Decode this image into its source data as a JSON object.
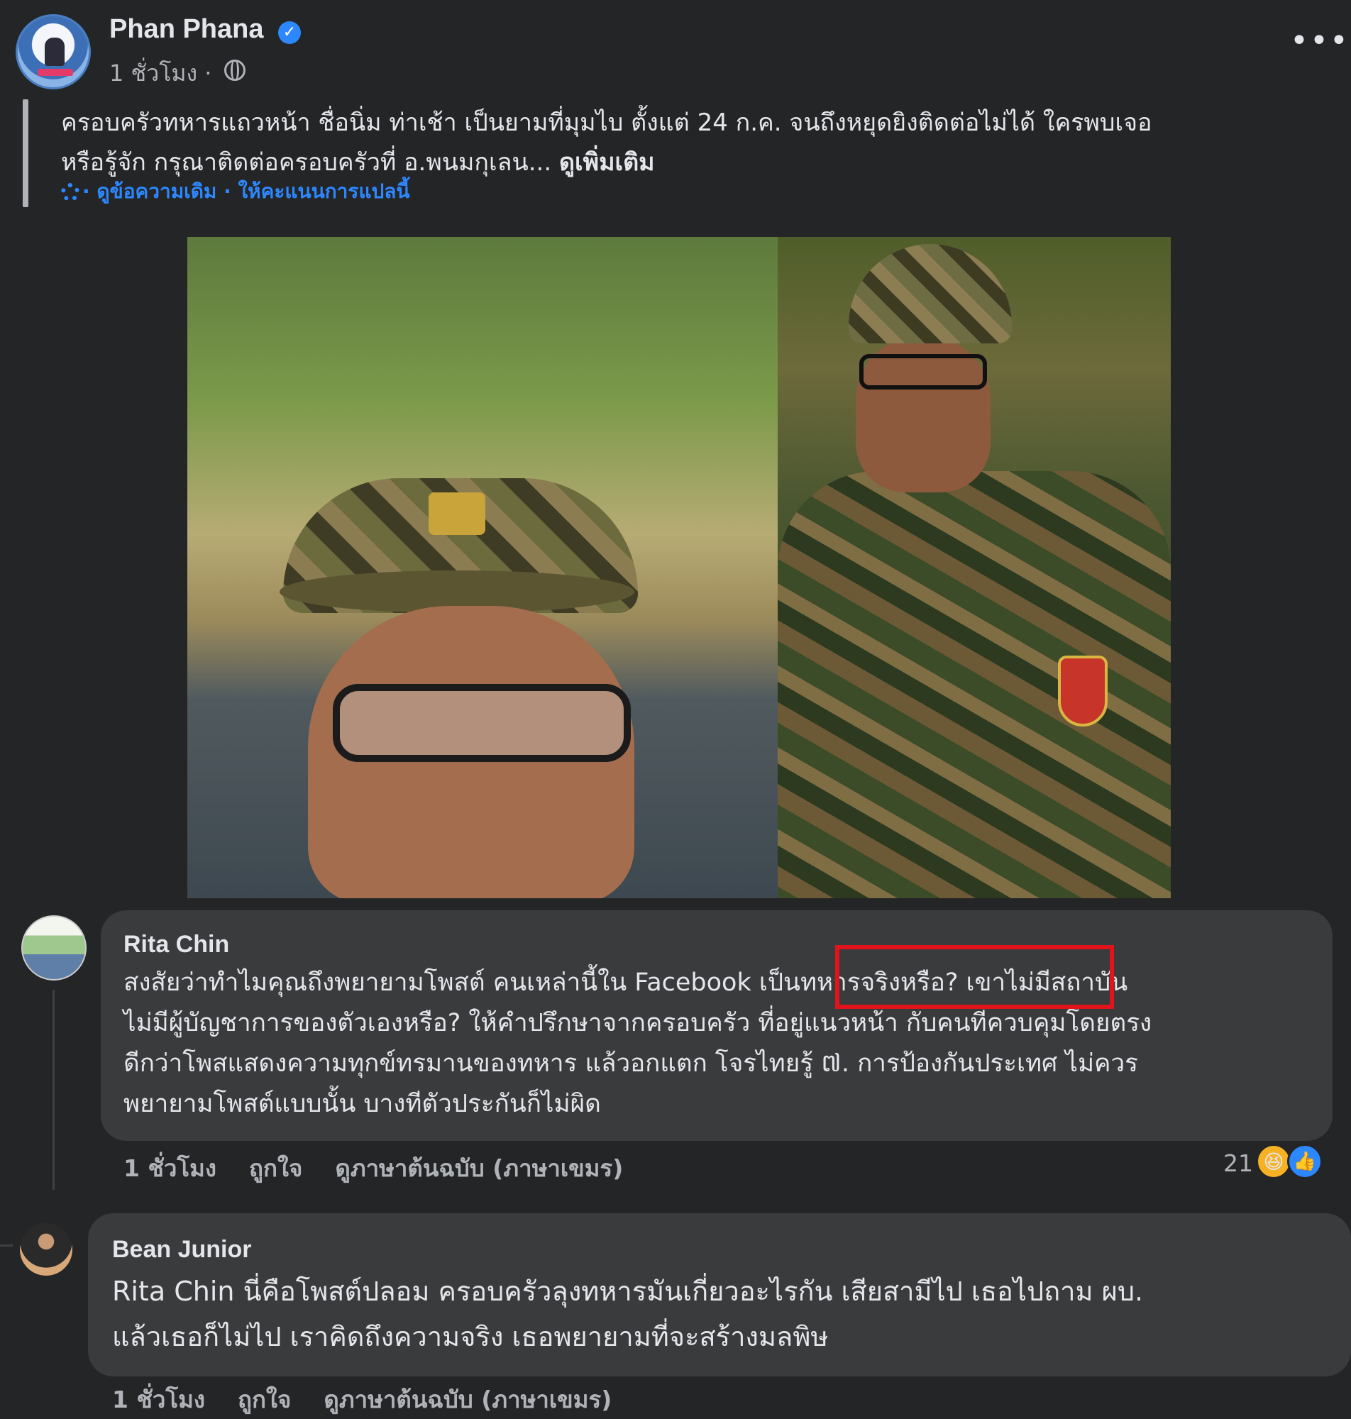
{
  "post": {
    "author": "Phan Phana",
    "verified_mark": "✓",
    "time": "1 ชั่วโมง ·",
    "more_label": "•••",
    "text_line1": "ครอบครัวทหารแถวหน้า ชื่อนิ่ม ท่าเช้า เป็นยามที่มุมไบ ตั้งแต่ 24 ก.ค. จนถึงหยุดยิงติดต่อไม่ได้ ใครพบเจอ",
    "text_line2": "หรือรู้จัก กรุณาติดต่อครอบครัวที่ อ.พนมกุเลน...",
    "see_more": "ดูเพิ่มเติม",
    "translation_links": "· ดูข้อความเดิม · ให้คะแนนการแปลนี้",
    "icons": [
      "verified-icon",
      "globe-icon",
      "more-icon",
      "gear-icon"
    ]
  },
  "comments": [
    {
      "name": "Rita Chin",
      "lines": [
        "สงสัยว่าทำไมคุณถึงพยายามโพสต์ คนเหล่านี้ใน Facebook เป็นทหารจริงหรือ? เขาไม่มีสถาบัน",
        "ไม่มีผู้บัญชาการของตัวเองหรือ? ให้คำปรึกษาจากครอบครัว ที่อยู่แนวหน้า กับคนที่ควบคุมโดยตรง",
        "ดีกว่าโพสแสดงความทุกข์ทรมานของทหาร แล้วอกแตก โจรไทยรู้ ៧. การป้องกันประเทศ ไม่ควร",
        "พยายามโพสต์แบบนั้น บางทีตัวประกันก็ไม่ผิด"
      ],
      "time": "1 ชั่วโมง",
      "like": "ถูกใจ",
      "see_original": "ดูภาษาต้นฉบับ (ภาษาเขมร)",
      "reaction_count": "21",
      "reactions": [
        "haha-icon",
        "like-icon"
      ]
    },
    {
      "name": "Bean Junior",
      "lines": [
        "Rita Chin นี่คือโพสต์ปลอม ครอบครัวลุงทหารมันเกี่ยวอะไรกัน เสียสามีไป เธอไปถาม ผบ.",
        "แล้วเธอก็ไม่ไป เราคิดถึงความจริง เธอพยายามที่จะสร้างมลพิษ"
      ],
      "time": "1 ชั่วโมง",
      "like": "ถูกใจ",
      "see_original": "ดูภาษาต้นฉบับ (ภาษาเขมร)"
    }
  ],
  "colors": {
    "background": "#242526",
    "bubble": "#3a3b3c",
    "link": "#2d88ff",
    "highlight_box": "#e0141a"
  }
}
